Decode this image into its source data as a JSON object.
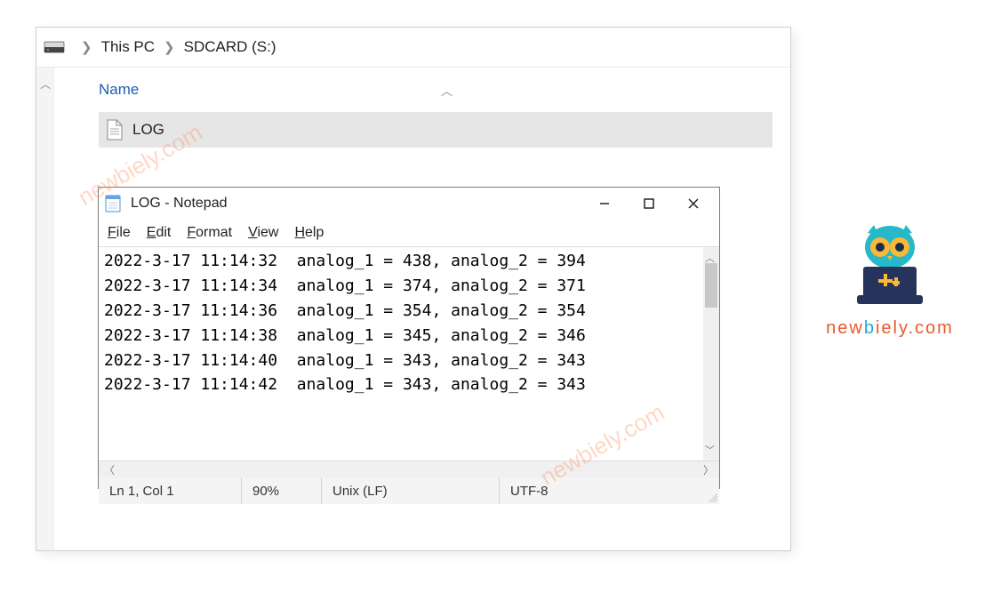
{
  "breadcrumb": {
    "items": [
      "This PC",
      "SDCARD (S:)"
    ]
  },
  "explorer": {
    "column_header": "Name",
    "file_name": "LOG"
  },
  "notepad": {
    "title": "LOG - Notepad",
    "menu": {
      "file": "File",
      "edit": "Edit",
      "format": "Format",
      "view": "View",
      "help": "Help"
    },
    "lines": [
      "2022-3-17 11:14:32  analog_1 = 438, analog_2 = 394",
      "2022-3-17 11:14:34  analog_1 = 374, analog_2 = 371",
      "2022-3-17 11:14:36  analog_1 = 354, analog_2 = 354",
      "2022-3-17 11:14:38  analog_1 = 345, analog_2 = 346",
      "2022-3-17 11:14:40  analog_1 = 343, analog_2 = 343",
      "2022-3-17 11:14:42  analog_1 = 343, analog_2 = 343"
    ],
    "status": {
      "pos": "Ln 1, Col 1",
      "zoom": "90%",
      "eol": "Unix (LF)",
      "encoding": "UTF-8"
    }
  },
  "watermark": "newbiely.com",
  "logo_text": "newbiely.com"
}
